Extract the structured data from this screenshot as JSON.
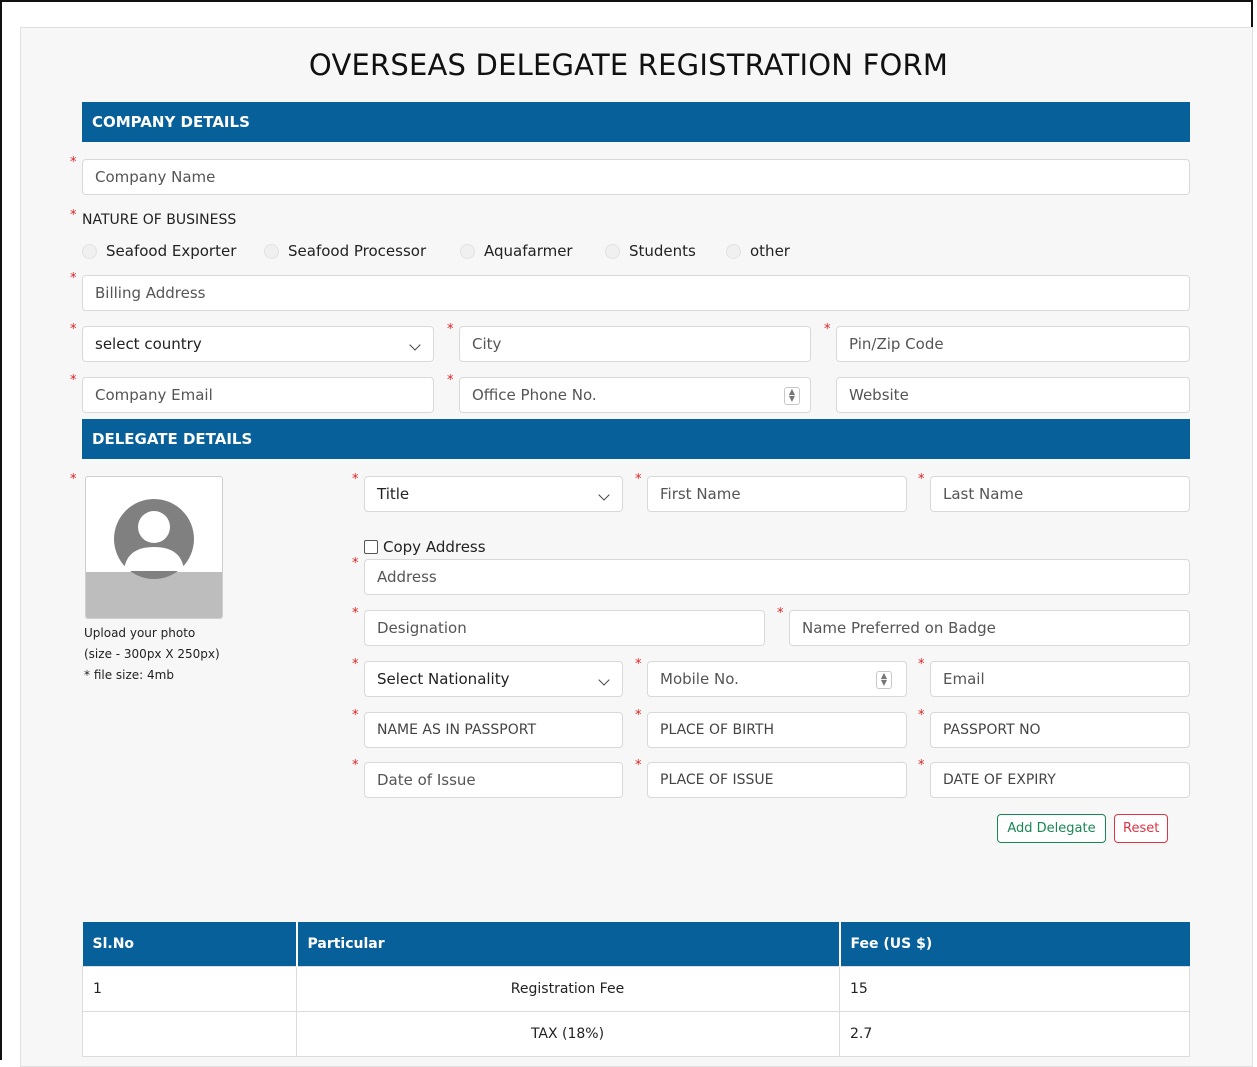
{
  "form": {
    "title": "OVERSEAS DELEGATE REGISTRATION FORM"
  },
  "company": {
    "header": "COMPANY DETAILS",
    "company_name_placeholder": "Company Name",
    "nature_label": "NATURE OF BUSINESS",
    "nature_options": [
      "Seafood Exporter",
      "Seafood Processor",
      "Aquafarmer",
      "Students",
      "other"
    ],
    "billing_address_placeholder": "Billing Address",
    "country_select": "select country",
    "city_placeholder": "City",
    "zip_placeholder": "Pin/Zip Code",
    "email_placeholder": "Company Email",
    "phone_placeholder": "Office Phone No.",
    "website_placeholder": "Website"
  },
  "delegate": {
    "header": "DELEGATE DETAILS",
    "title_select": "Title",
    "first_name_placeholder": "First Name",
    "last_name_placeholder": "Last Name",
    "copy_address_label": "Copy Address",
    "address_placeholder": "Address",
    "designation_placeholder": "Designation",
    "badge_name_placeholder": "Name Preferred on Badge",
    "nationality_select": "Select Nationality",
    "mobile_placeholder": "Mobile No.",
    "email_placeholder": "Email",
    "passport_name_placeholder": "NAME AS IN PASSPORT",
    "birth_place_placeholder": "PLACE OF BIRTH",
    "passport_no_placeholder": "PASSPORT NO",
    "issue_date_placeholder": "Date of Issue",
    "issue_place_placeholder": "PLACE OF ISSUE",
    "expiry_placeholder": "DATE OF EXPIRY",
    "photo_upload": {
      "line1": "Upload your photo",
      "line2": "(size - 300px X 250px)",
      "line3": "* file size: 4mb"
    },
    "add_button": "Add Delegate",
    "reset_button": "Reset"
  },
  "fee_table": {
    "headers": [
      "Sl.No",
      "Particular",
      "Fee (US $)"
    ],
    "rows": [
      [
        "1",
        "Registration Fee",
        "15"
      ],
      [
        "",
        "TAX (18%)",
        "2.7"
      ]
    ]
  },
  "colors": {
    "band": "#08609a",
    "required": "#e02020",
    "add": "#198754",
    "reset": "#dc3545"
  }
}
